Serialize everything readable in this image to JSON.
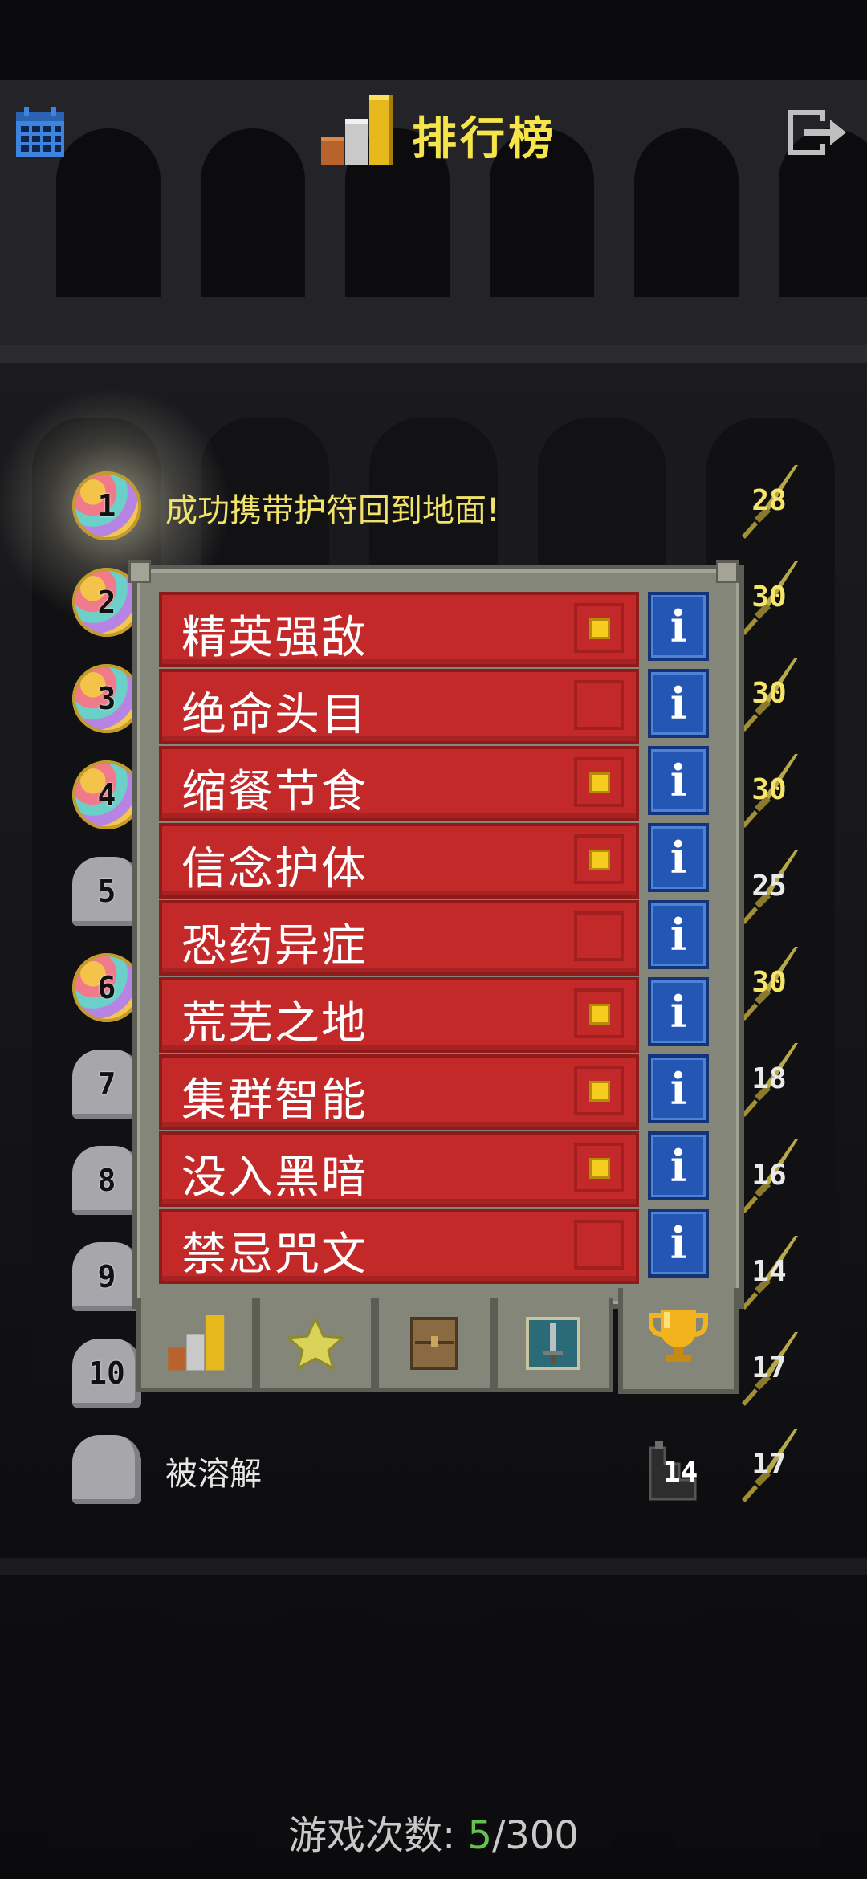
{
  "header": {
    "title": "排行榜",
    "calendar_icon": "calendar-icon",
    "exit_icon": "exit-icon",
    "title_icon": "leaderboard-bars-icon"
  },
  "rankings": [
    {
      "rank": "1",
      "badge": "gem",
      "text": "成功携带护符回到地面!",
      "score": "28"
    },
    {
      "rank": "2",
      "badge": "gem",
      "text": "",
      "score": "30"
    },
    {
      "rank": "3",
      "badge": "gem",
      "text": "",
      "score": "30"
    },
    {
      "rank": "4",
      "badge": "gem",
      "text": "",
      "score": "30"
    },
    {
      "rank": "5",
      "badge": "grave",
      "text": "",
      "score": "25"
    },
    {
      "rank": "6",
      "badge": "gem",
      "text": "",
      "score": "30"
    },
    {
      "rank": "7",
      "badge": "grave",
      "text": "",
      "score": "18"
    },
    {
      "rank": "8",
      "badge": "grave",
      "text": "",
      "score": "16"
    },
    {
      "rank": "9",
      "badge": "grave",
      "text": "",
      "score": "14"
    },
    {
      "rank": "10",
      "badge": "grave",
      "text": "",
      "score": "17"
    },
    {
      "rank": "",
      "badge": "grave",
      "text": "被溶解",
      "depth": "14",
      "score": "17"
    }
  ],
  "challenges": [
    {
      "label": "精英强敌",
      "enabled": true
    },
    {
      "label": "绝命头目",
      "enabled": false
    },
    {
      "label": "缩餐节食",
      "enabled": true
    },
    {
      "label": "信念护体",
      "enabled": true
    },
    {
      "label": "恐药异症",
      "enabled": false
    },
    {
      "label": "荒芜之地",
      "enabled": true
    },
    {
      "label": "集群智能",
      "enabled": true
    },
    {
      "label": "没入黑暗",
      "enabled": true
    },
    {
      "label": "禁忌咒文",
      "enabled": false
    }
  ],
  "info_button_label": "i",
  "tabs": [
    {
      "icon": "leaderboard-tab-icon"
    },
    {
      "icon": "badges-star-icon"
    },
    {
      "icon": "journal-chest-icon"
    },
    {
      "icon": "catalog-sword-icon"
    },
    {
      "icon": "trophy-icon",
      "active": true
    }
  ],
  "footer": {
    "label": "游戏次数: ",
    "current": "5",
    "total": "/300"
  },
  "colors": {
    "title": "#f5e54a",
    "challenge_row": "#c42929",
    "info_button": "#2457b3",
    "checkbox_fill": "#f6cc1f",
    "games_current": "#65c24e"
  }
}
